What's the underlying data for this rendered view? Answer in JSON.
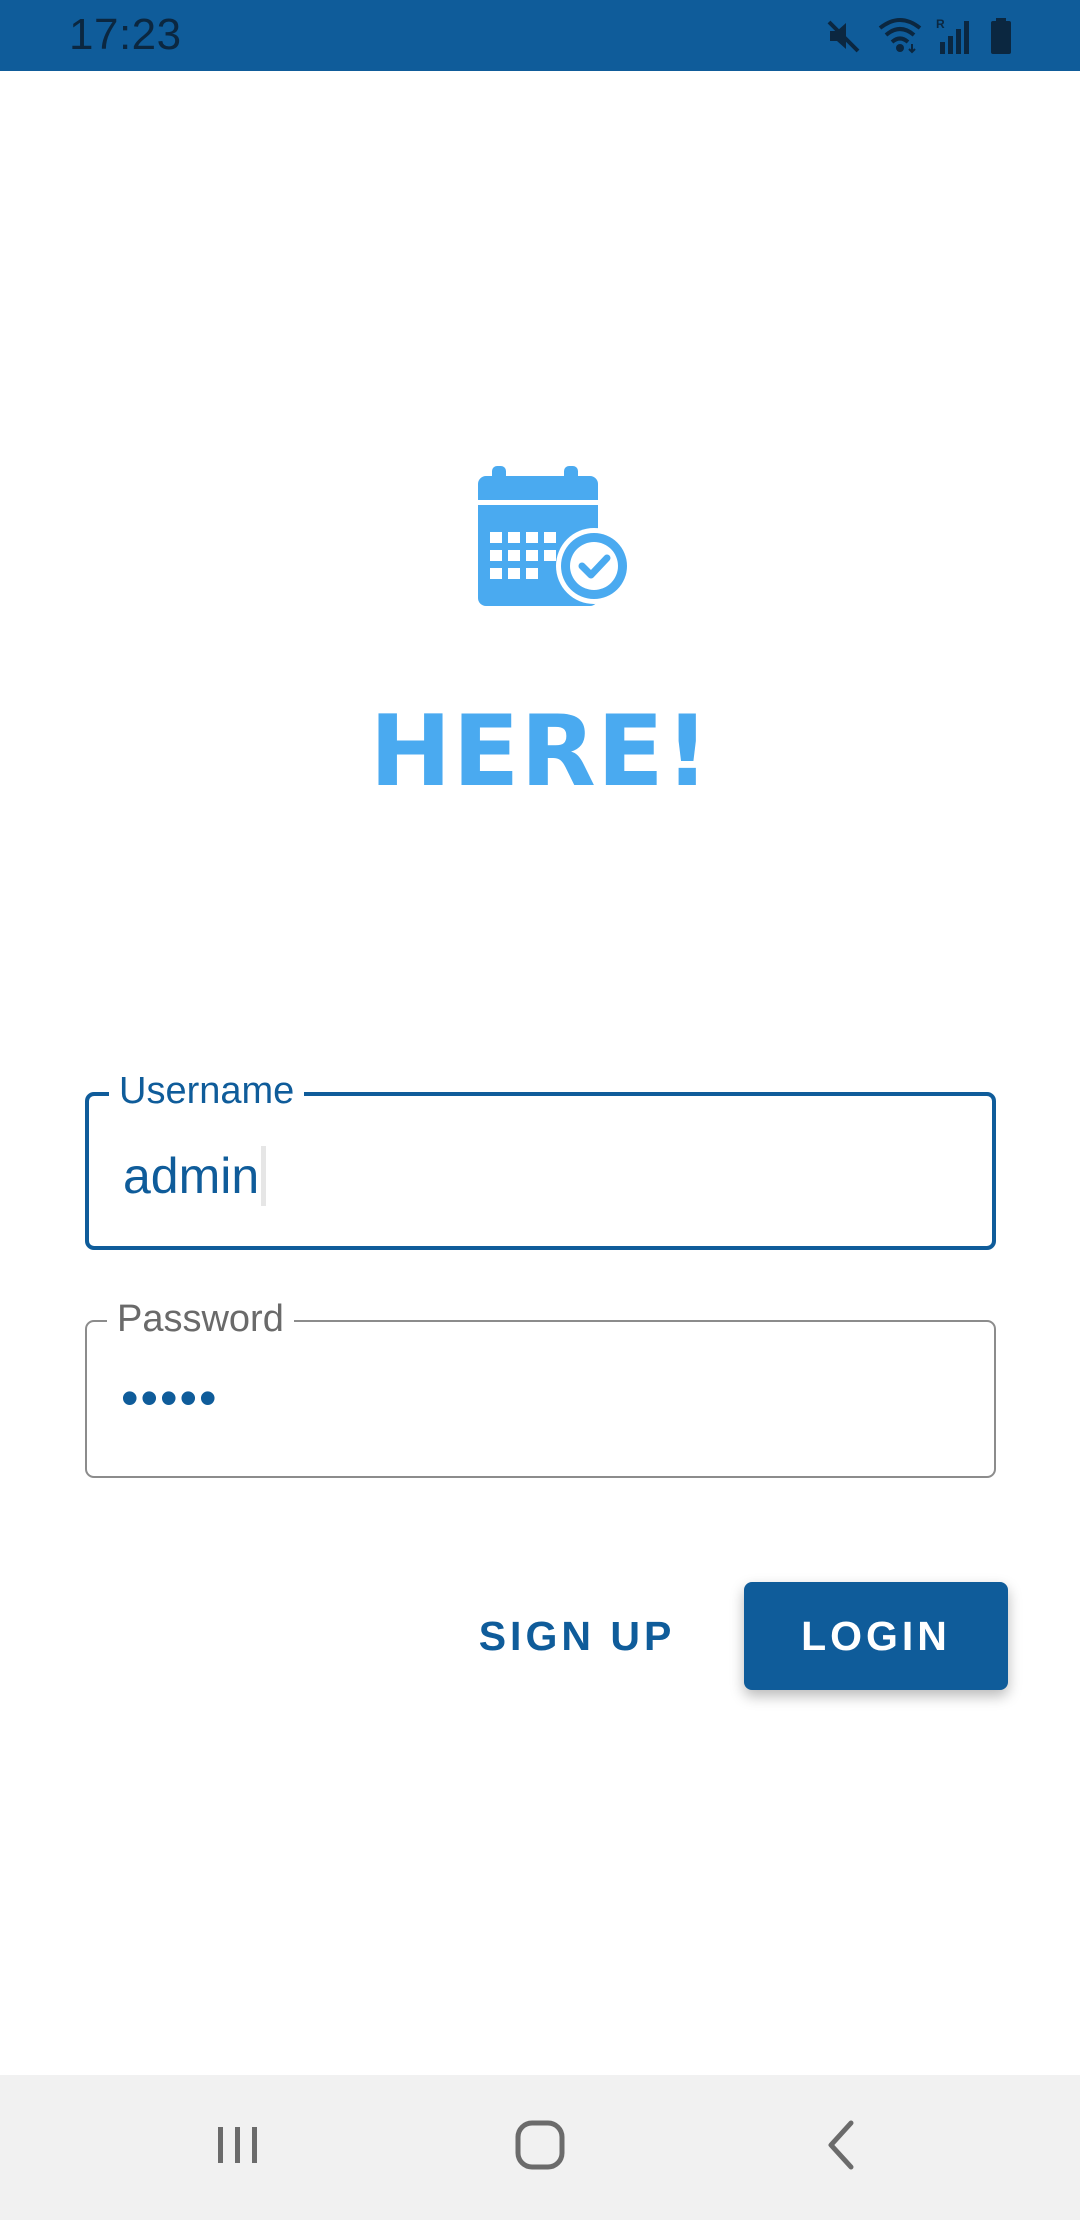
{
  "status_bar": {
    "time": "17:23",
    "icons": [
      "mute-icon",
      "wifi-icon",
      "signal-icon",
      "battery-icon"
    ],
    "background_color": "#0f5c9a"
  },
  "app": {
    "logo_icon": "calendar-check-icon",
    "title": "HERE!",
    "accent_color": "#4aaaf0",
    "primary_color": "#0f5c9a"
  },
  "form": {
    "username": {
      "label": "Username",
      "value": "admin",
      "focused": true
    },
    "password": {
      "label": "Password",
      "masked_value": "•••••"
    }
  },
  "buttons": {
    "signup_label": "SIGN UP",
    "login_label": "LOGIN"
  },
  "nav_bar": {
    "items": [
      "recents-icon",
      "home-icon",
      "back-icon"
    ]
  }
}
